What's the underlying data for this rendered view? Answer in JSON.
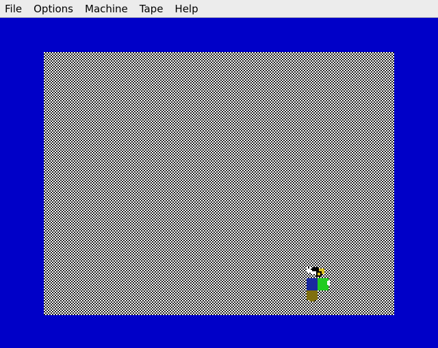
{
  "menubar": {
    "items": [
      {
        "label": "File"
      },
      {
        "label": "Options"
      },
      {
        "label": "Machine"
      },
      {
        "label": "Tape"
      },
      {
        "label": "Help"
      }
    ]
  },
  "colors": {
    "border": "#0000c8",
    "menubar_bg": "#ececec",
    "checker_dark": "#202020",
    "checker_light": "#ffffff",
    "sprite_blue": "#1a2aa0",
    "sprite_green": "#22cc22",
    "sprite_yellow": "#d8c020",
    "sprite_olive": "#807010"
  }
}
